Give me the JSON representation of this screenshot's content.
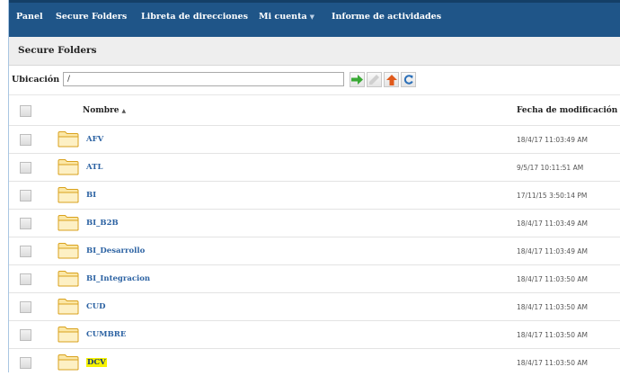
{
  "nav": {
    "items": [
      {
        "label": "Panel"
      },
      {
        "label": "Secure Folders"
      },
      {
        "label": "Libreta de direcciones"
      },
      {
        "label": "Mi cuenta",
        "caret": "▼"
      },
      {
        "label": "Informe de actividades"
      }
    ]
  },
  "page": {
    "title": "Secure Folders"
  },
  "location": {
    "label": "Ubicación",
    "value": "/"
  },
  "toolbar": {
    "buttons": [
      {
        "icon": "go-arrow-icon",
        "color": "#39a935"
      },
      {
        "icon": "edit-pencil-icon",
        "color": "#c8c8c8"
      },
      {
        "icon": "up-folder-icon",
        "color": "#e05a1c"
      },
      {
        "icon": "refresh-icon",
        "color": "#2b6fb8"
      }
    ]
  },
  "table": {
    "columns": {
      "name": "Nombre",
      "name_sort": "▲",
      "date": "Fecha de modificación"
    },
    "rows": [
      {
        "name": "AFV",
        "date": "18/4/17 11:03:49 AM"
      },
      {
        "name": "ATL",
        "date": "9/5/17 10:11:51 AM"
      },
      {
        "name": "BI",
        "date": "17/11/15 3:50:14 PM"
      },
      {
        "name": "BI_B2B",
        "date": "18/4/17 11:03:49 AM"
      },
      {
        "name": "BI_Desarrollo",
        "date": "18/4/17 11:03:49 AM"
      },
      {
        "name": "BI_Integracion",
        "date": "18/4/17 11:03:50 AM"
      },
      {
        "name": "CUD",
        "date": "18/4/17 11:03:50 AM"
      },
      {
        "name": "CUMBRE",
        "date": "18/4/17 11:03:50 AM"
      },
      {
        "name": "DCV",
        "date": "18/4/17 11:03:50 AM",
        "highlighted": true
      }
    ]
  },
  "colors": {
    "nav_bg": "#1f5588",
    "link": "#2d63a3",
    "folder": "#f8c233",
    "highlight": "#f6f200"
  }
}
